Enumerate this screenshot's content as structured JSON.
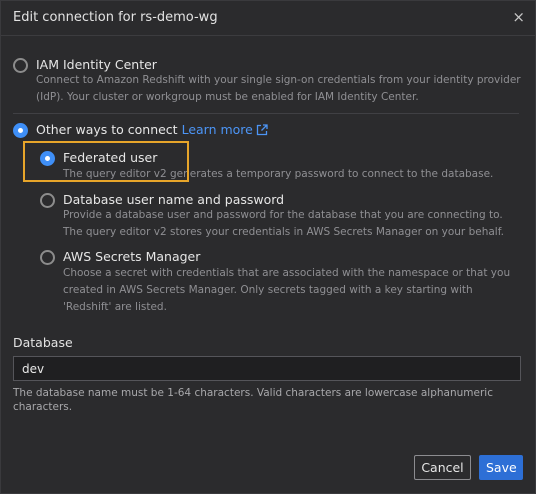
{
  "dialog": {
    "title": "Edit connection for rs-demo-wg",
    "close_glyph": "×"
  },
  "options": {
    "iam": {
      "label": "IAM Identity Center",
      "desc_line1": "Connect to Amazon Redshift with your single sign-on credentials from your identity provider",
      "desc_line2": "(IdP). Your cluster or workgroup must be enabled for IAM Identity Center.",
      "selected": false
    },
    "other": {
      "label": "Other ways to connect",
      "learn_more": "Learn more",
      "selected": true
    },
    "federated": {
      "label": "Federated user",
      "desc_line1": "The query editor v2 generates a temporary password to connect to the database.",
      "selected": true
    },
    "db_user": {
      "label": "Database user name and password",
      "desc_line1": "Provide a database user and password for the database that you are connecting to.",
      "desc_line2": "The query editor v2 stores your credentials in AWS Secrets Manager on your behalf.",
      "selected": false
    },
    "secrets": {
      "label": "AWS Secrets Manager",
      "desc_line1": "Choose a secret with credentials that are associated with the namespace or that you",
      "desc_line2": "created in AWS Secrets Manager. Only secrets tagged with a key starting with",
      "desc_line3": "'Redshift' are listed.",
      "selected": false
    }
  },
  "database": {
    "label": "Database",
    "value": "dev",
    "help": "The database name must be 1-64 characters. Valid characters are lowercase alphanumeric characters."
  },
  "footer": {
    "cancel_label": "Cancel",
    "save_label": "Save"
  },
  "colors": {
    "accent": "#3f8ff7",
    "highlight": "#e7a52a",
    "primary_button": "#2d6fd6"
  },
  "icons": {
    "close": "close-icon",
    "external_link": "external-link-icon"
  }
}
